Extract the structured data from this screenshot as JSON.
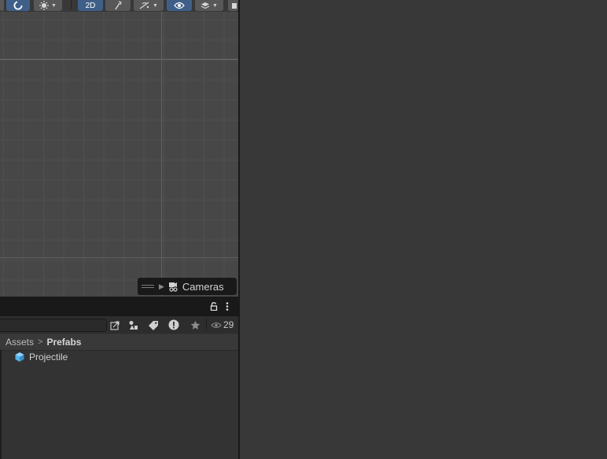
{
  "toolbar": {
    "items": [
      {
        "name": "orbit-toggle",
        "icon": "orbit-icon",
        "active": true
      },
      {
        "name": "gizmos-dropdown",
        "icon": "sun-gizmo-icon"
      },
      {
        "name": "2d-toggle",
        "label": "2D",
        "active": true
      },
      {
        "name": "lighting-toggle",
        "icon": "light-icon"
      },
      {
        "name": "effects-dropdown",
        "icon": "effects-icon"
      },
      {
        "name": "visibility-toggle",
        "icon": "eye-icon",
        "active": true
      },
      {
        "name": "layers-dropdown",
        "icon": "layers-icon"
      }
    ],
    "mode_2d_label": "2D"
  },
  "scene": {
    "overlay_label": "Cameras",
    "overlay_icon": "camera-icon"
  },
  "project": {
    "header_icons": [
      "lock-icon",
      "kebab-menu-icon"
    ],
    "toolbar_icons": [
      "create-icon",
      "filter-type-icon",
      "label-icon",
      "warning-icon",
      "favorite-star-icon",
      "eye-icon"
    ],
    "hidden_count": "29",
    "breadcrumb": {
      "root": "Assets",
      "separator": ">",
      "current": "Prefabs"
    },
    "assets": [
      {
        "name": "Projectile",
        "icon": "prefab-cube-icon"
      }
    ]
  },
  "colors": {
    "accent_active": "#3f5f88",
    "panel_bg": "#383838",
    "scene_bg": "#474747",
    "prefab_icon": "#56b4e9"
  }
}
